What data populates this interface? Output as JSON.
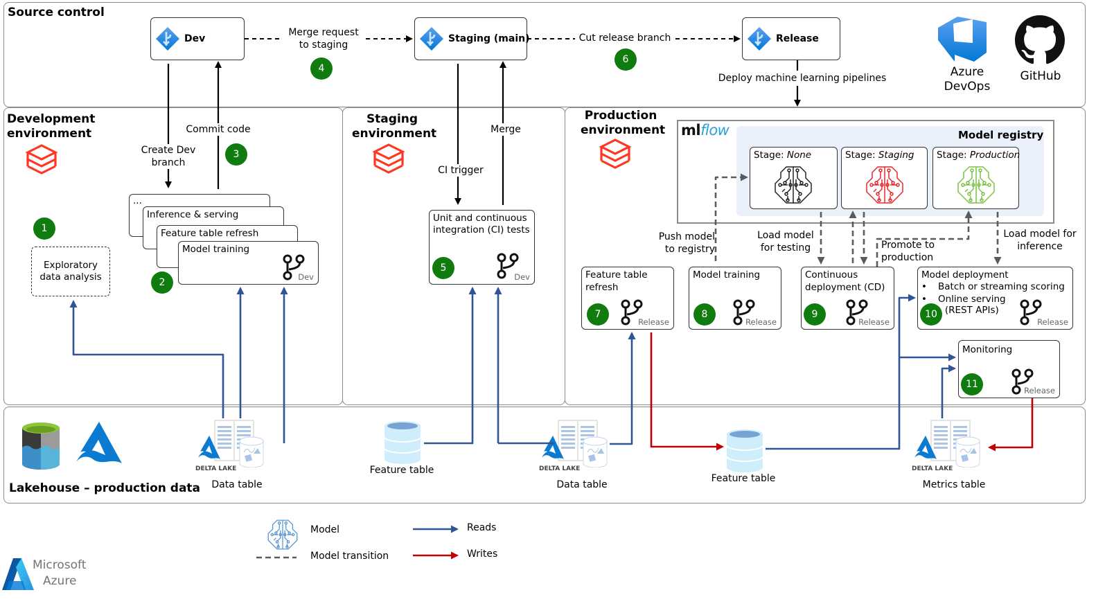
{
  "source_control": {
    "title": "Source control",
    "branches": {
      "dev": "Dev",
      "staging": "Staging (main)",
      "release": "Release"
    },
    "merge_request_label": "Merge request\nto staging",
    "cut_release_label": "Cut release branch",
    "deploy_pipelines_label": "Deploy machine learning pipelines",
    "tools": [
      {
        "name": "Azure\nDevOps",
        "icon": "azure-devops-icon"
      },
      {
        "name": "GitHub",
        "icon": "github-icon"
      }
    ]
  },
  "development": {
    "title": "Development\nenvironment",
    "create_branch_label": "Create Dev\nbranch",
    "commit_label": "Commit code",
    "eda_label": "Exploratory\ndata analysis",
    "stacked_cards": [
      "...",
      "Inference & serving",
      "Feature table refresh",
      "Model training"
    ],
    "branch_tag": "Dev"
  },
  "staging": {
    "title": "Staging\nenvironment",
    "ci_trigger_label": "CI trigger",
    "merge_label": "Merge",
    "ci_card": "Unit and continuous\nintegration (CI) tests",
    "branch_tag": "Dev"
  },
  "production": {
    "title": "Production\nenvironment",
    "mlflow_brand": {
      "ml": "ml",
      "flow": "flow"
    },
    "registry_title": "Model registry",
    "stages": [
      {
        "prefix": "Stage: ",
        "name": "None",
        "color": "#222222"
      },
      {
        "prefix": "Stage: ",
        "name": "Staging",
        "color": "#e8262b"
      },
      {
        "prefix": "Stage: ",
        "name": "Production",
        "color": "#7cc242"
      }
    ],
    "push_label": "Push model\nto registry",
    "load_testing_label": "Load model\nfor testing",
    "promote_label": "Promote to\nproduction",
    "load_inference_label": "Load model for\ninference",
    "cards": {
      "feature_refresh": "Feature table\nrefresh",
      "model_training": "Model training",
      "cd": "Continuous\ndeployment (CD)",
      "deployment_title": "Model deployment",
      "deployment_bullets": [
        "Batch or streaming scoring",
        "Online serving\n(REST APIs)"
      ],
      "monitoring": "Monitoring"
    },
    "branch_tag": "Release"
  },
  "steps": [
    "1",
    "2",
    "3",
    "4",
    "5",
    "6",
    "7",
    "8",
    "9",
    "10",
    "11"
  ],
  "lakehouse": {
    "title": "Lakehouse – production data",
    "delta_lake_text": "DELTA LAKE",
    "stores": [
      "Data table",
      "Feature table",
      "Data table",
      "Feature table",
      "Metrics table"
    ]
  },
  "legend": {
    "model": "Model",
    "model_transition": "Model transition",
    "reads": "Reads",
    "writes": "Writes"
  },
  "branding": {
    "line1": "Microsoft",
    "line2": "Azure"
  },
  "colors": {
    "step_green": "#107c10",
    "reads_blue": "#2f5597",
    "writes_red": "#c00000",
    "databricks_red": "#ff3621",
    "registry_bg": "#eaf1fa"
  }
}
